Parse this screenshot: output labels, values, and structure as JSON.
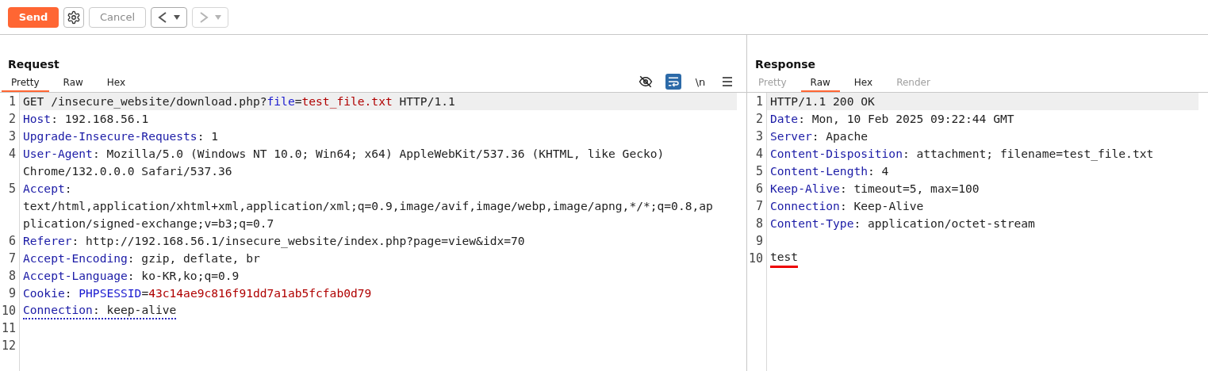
{
  "toolbar": {
    "send": {
      "label": "Send"
    },
    "cancel": {
      "label": "Cancel",
      "disabled": true
    },
    "back": {
      "disabled": false
    },
    "forward": {
      "disabled": true
    }
  },
  "request": {
    "title": "Request",
    "tabs": [
      {
        "label": "Pretty",
        "selected": true,
        "disabled": false
      },
      {
        "label": "Raw",
        "selected": false,
        "disabled": false
      },
      {
        "label": "Hex",
        "selected": false,
        "disabled": false
      }
    ],
    "tools": {
      "hide_whitespace": false,
      "wrap_lines": true,
      "newline_label": "\\n"
    },
    "lines": [
      {
        "number": "1",
        "highlighted": true,
        "warning": false,
        "segments": [
          {
            "kind": "plain",
            "text": "GET /insecure_website/download.php?"
          },
          {
            "kind": "param",
            "text": "file"
          },
          {
            "kind": "plain",
            "text": "="
          },
          {
            "kind": "value",
            "text": "test_file.txt"
          },
          {
            "kind": "plain",
            "text": " HTTP/1.1"
          }
        ]
      },
      {
        "number": "2",
        "highlighted": false,
        "warning": false,
        "segments": [
          {
            "kind": "key",
            "text": "Host"
          },
          {
            "kind": "plain",
            "text": ": 192.168.56.1"
          }
        ]
      },
      {
        "number": "3",
        "highlighted": false,
        "warning": false,
        "segments": [
          {
            "kind": "key",
            "text": "Upgrade-Insecure-Requests"
          },
          {
            "kind": "plain",
            "text": ": 1"
          }
        ]
      },
      {
        "number": "4",
        "highlighted": false,
        "warning": false,
        "segments": [
          {
            "kind": "key",
            "text": "User-Agent"
          },
          {
            "kind": "plain",
            "text": ": Mozilla/5.0 (Windows NT 10.0; Win64; x64) AppleWebKit/537.36 (KHTML, like Gecko)"
          }
        ]
      },
      {
        "highlighted": false,
        "warning": false,
        "segments": [
          {
            "kind": "plain",
            "text": "Chrome/132.0.0.0 Safari/537.36"
          }
        ]
      },
      {
        "number": "5",
        "highlighted": false,
        "warning": false,
        "segments": [
          {
            "kind": "key",
            "text": "Accept"
          },
          {
            "kind": "plain",
            "text": ":"
          }
        ]
      },
      {
        "highlighted": false,
        "warning": false,
        "segments": [
          {
            "kind": "plain",
            "text": "text/html,application/xhtml+xml,application/xml;q=0.9,image/avif,image/webp,image/apng,*/*;q=0.8,ap"
          }
        ]
      },
      {
        "highlighted": false,
        "warning": false,
        "segments": [
          {
            "kind": "plain",
            "text": "plication/signed-exchange;v=b3;q=0.7"
          }
        ]
      },
      {
        "number": "6",
        "highlighted": false,
        "warning": false,
        "segments": [
          {
            "kind": "key",
            "text": "Referer"
          },
          {
            "kind": "plain",
            "text": ": http://192.168.56.1/insecure_website/index.php?page=view&idx=70"
          }
        ]
      },
      {
        "number": "7",
        "highlighted": false,
        "warning": false,
        "segments": [
          {
            "kind": "key",
            "text": "Accept-Encoding"
          },
          {
            "kind": "plain",
            "text": ": gzip, deflate, br"
          }
        ]
      },
      {
        "number": "8",
        "highlighted": false,
        "warning": false,
        "segments": [
          {
            "kind": "key",
            "text": "Accept-Language"
          },
          {
            "kind": "plain",
            "text": ": ko-KR,ko;q=0.9"
          }
        ]
      },
      {
        "number": "9",
        "highlighted": false,
        "warning": false,
        "segments": [
          {
            "kind": "key",
            "text": "Cookie"
          },
          {
            "kind": "plain",
            "text": ": "
          },
          {
            "kind": "param",
            "text": "PHPSESSID"
          },
          {
            "kind": "plain",
            "text": "="
          },
          {
            "kind": "value",
            "text": "43c14ae9c816f91dd7a1ab5fcfab0d79"
          }
        ]
      },
      {
        "number": "10",
        "highlighted": false,
        "warning": true,
        "segments": [
          {
            "kind": "key",
            "text": "Connection"
          },
          {
            "kind": "plain",
            "text": ": keep-alive"
          }
        ]
      },
      {
        "number": "11",
        "highlighted": false
      },
      {
        "number": "12",
        "highlighted": false
      }
    ]
  },
  "response": {
    "title": "Response",
    "tabs": [
      {
        "label": "Pretty",
        "selected": false,
        "disabled": true
      },
      {
        "label": "Raw",
        "selected": true,
        "disabled": false
      },
      {
        "label": "Hex",
        "selected": false,
        "disabled": false
      },
      {
        "label": "Render",
        "selected": false,
        "disabled": true
      }
    ],
    "lines": [
      {
        "number": "1",
        "highlighted": true,
        "marked": false,
        "segments": [
          {
            "kind": "plain",
            "text": "HTTP/1.1 200 OK"
          }
        ]
      },
      {
        "number": "2",
        "highlighted": false,
        "marked": false,
        "segments": [
          {
            "kind": "key",
            "text": "Date"
          },
          {
            "kind": "plain",
            "text": ": Mon, 10 Feb 2025 09:22:44 GMT"
          }
        ]
      },
      {
        "number": "3",
        "highlighted": false,
        "marked": false,
        "segments": [
          {
            "kind": "key",
            "text": "Server"
          },
          {
            "kind": "plain",
            "text": ": Apache"
          }
        ]
      },
      {
        "number": "4",
        "highlighted": false,
        "marked": false,
        "segments": [
          {
            "kind": "key",
            "text": "Content-Disposition"
          },
          {
            "kind": "plain",
            "text": ": attachment; filename=test_file.txt"
          }
        ]
      },
      {
        "number": "5",
        "highlighted": false,
        "marked": false,
        "segments": [
          {
            "kind": "key",
            "text": "Content-Length"
          },
          {
            "kind": "plain",
            "text": ": 4"
          }
        ]
      },
      {
        "number": "6",
        "highlighted": false,
        "marked": false,
        "segments": [
          {
            "kind": "key",
            "text": "Keep-Alive"
          },
          {
            "kind": "plain",
            "text": ": timeout=5, max=100"
          }
        ]
      },
      {
        "number": "7",
        "highlighted": false,
        "marked": false,
        "segments": [
          {
            "kind": "key",
            "text": "Connection"
          },
          {
            "kind": "plain",
            "text": ": Keep-Alive"
          }
        ]
      },
      {
        "number": "8",
        "highlighted": false,
        "marked": false,
        "segments": [
          {
            "kind": "key",
            "text": "Content-Type"
          },
          {
            "kind": "plain",
            "text": ": application/octet-stream"
          }
        ]
      },
      {
        "number": "9",
        "highlighted": false
      },
      {
        "number": "10",
        "highlighted": false,
        "marked": true,
        "segments": [
          {
            "kind": "plain",
            "text": "test"
          }
        ]
      }
    ]
  }
}
